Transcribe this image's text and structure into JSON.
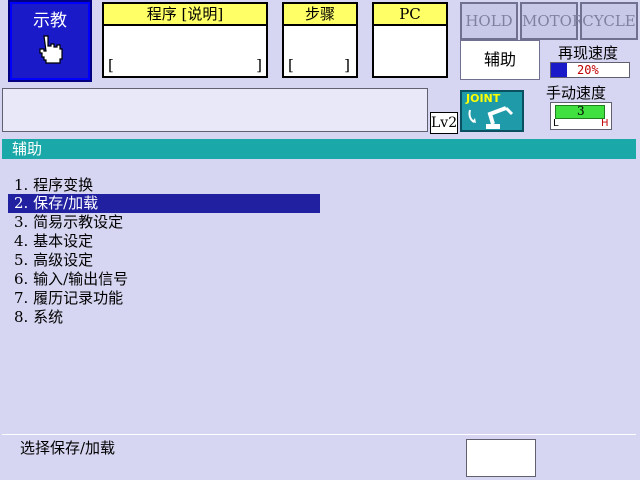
{
  "mode": {
    "label": "示教",
    "icon": "hand-pointer-icon"
  },
  "program_panel": {
    "title": "程序 [说明]",
    "bracket_left": "[",
    "bracket_right": "]"
  },
  "step_panel": {
    "title": "步骤",
    "bracket_left": "[",
    "bracket_right": "]"
  },
  "pc_panel": {
    "title": "PC"
  },
  "status": {
    "hold": "HOLD",
    "motor": "MOTOR",
    "cycle": "CYCLE"
  },
  "assist_button": "辅助",
  "replay_speed": {
    "label": "再现速度",
    "value": "20%"
  },
  "manual_speed": {
    "label": "手动速度",
    "value": "3",
    "low": "L",
    "high": "H"
  },
  "level": "Lv2",
  "joint": {
    "label": "JOINT",
    "icon": "robot-arm-icon"
  },
  "section_title": "辅助",
  "menu": [
    {
      "label": "1.  程序变换",
      "selected": false
    },
    {
      "label": "2.  保存/加载",
      "selected": true
    },
    {
      "label": "3.  简易示教设定",
      "selected": false
    },
    {
      "label": "4.  基本设定",
      "selected": false
    },
    {
      "label": "5.  高级设定",
      "selected": false
    },
    {
      "label": "6.  输入/输出信号",
      "selected": false
    },
    {
      "label": "7.  履历记录功能",
      "selected": false
    },
    {
      "label": "8.  系统",
      "selected": false
    }
  ],
  "prompt": "选择保存/加载",
  "colors": {
    "accent_teal": "#1aa8a8",
    "selection": "#2020a0",
    "mode_blue": "#1a1ac8",
    "panel_header": "#ffff66"
  }
}
